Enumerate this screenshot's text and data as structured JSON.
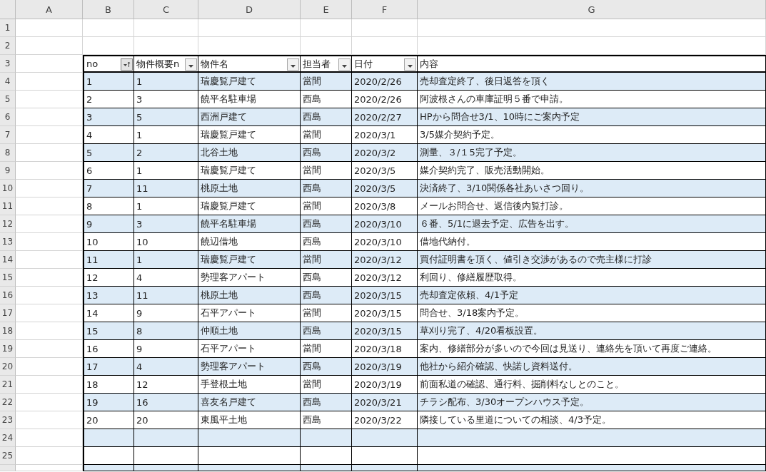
{
  "column_headings": [
    "A",
    "B",
    "C",
    "D",
    "E",
    "F",
    "G"
  ],
  "row_numbers": [
    "1",
    "2",
    "3",
    "4",
    "5",
    "6",
    "7",
    "8",
    "9",
    "10",
    "11",
    "12",
    "13",
    "14",
    "15",
    "16",
    "17",
    "18",
    "19",
    "20",
    "21",
    "22",
    "23",
    "24",
    "25"
  ],
  "table": {
    "columns": [
      {
        "label": "no",
        "filter_button": true,
        "sorted": true
      },
      {
        "label": "物件概要n",
        "filter_button": true,
        "sorted": false
      },
      {
        "label": "物件名",
        "filter_button": true,
        "sorted": false
      },
      {
        "label": "担当者",
        "filter_button": true,
        "sorted": false
      },
      {
        "label": "日付",
        "filter_button": true,
        "sorted": false
      },
      {
        "label": "内容",
        "filter_button": false,
        "sorted": false
      }
    ],
    "rows": [
      [
        "1",
        "1",
        "瑞慶覧戸建て",
        "當間",
        "2020/2/26",
        "売却査定終了、後日返答を頂く"
      ],
      [
        "2",
        "3",
        "饒平名駐車場",
        "西島",
        "2020/2/26",
        "阿波根さんの車庫証明５番で申請。"
      ],
      [
        "3",
        "5",
        "西洲戸建て",
        "西島",
        "2020/2/27",
        "HPから問合せ3/1、10時にご案内予定"
      ],
      [
        "4",
        "1",
        "瑞慶覧戸建て",
        "當間",
        "2020/3/1",
        "3/5媒介契約予定。"
      ],
      [
        "5",
        "2",
        "北谷土地",
        "西島",
        "2020/3/2",
        "測量、３/１5完了予定。"
      ],
      [
        "6",
        "1",
        "瑞慶覧戸建て",
        "當間",
        "2020/3/5",
        "媒介契約完了、販売活動開始。"
      ],
      [
        "7",
        "11",
        "桃原土地",
        "西島",
        "2020/3/5",
        "決済終了、3/10関係各社あいさつ回り。"
      ],
      [
        "8",
        "1",
        "瑞慶覧戸建て",
        "當間",
        "2020/3/8",
        "メールお問合せ、返信後内覧打診。"
      ],
      [
        "9",
        "3",
        "饒平名駐車場",
        "西島",
        "2020/3/10",
        "６番、5/1に退去予定、広告を出す。"
      ],
      [
        "10",
        "10",
        "饒辺借地",
        "西島",
        "2020/3/10",
        "借地代納付。"
      ],
      [
        "11",
        "1",
        "瑞慶覧戸建て",
        "當間",
        "2020/3/12",
        "買付証明書を頂く、値引き交渉があるので売主様に打診"
      ],
      [
        "12",
        "4",
        "勢理客アパート",
        "西島",
        "2020/3/12",
        "利回り、修繕履歴取得。"
      ],
      [
        "13",
        "11",
        "桃原土地",
        "西島",
        "2020/3/15",
        "売却査定依頼、4/1予定"
      ],
      [
        "14",
        "9",
        "石平アパート",
        "當間",
        "2020/3/15",
        "問合せ、3/18案内予定。"
      ],
      [
        "15",
        "8",
        "仲順土地",
        "西島",
        "2020/3/15",
        "草刈り完了、4/20看板設置。"
      ],
      [
        "16",
        "9",
        "石平アパート",
        "當間",
        "2020/3/18",
        "案内、修繕部分が多いので今回は見送り、連絡先を頂いて再度ご連絡。"
      ],
      [
        "17",
        "4",
        "勢理客アパート",
        "西島",
        "2020/3/19",
        "他社から紹介確認、快諾し資料送付。"
      ],
      [
        "18",
        "12",
        "手登根土地",
        "當間",
        "2020/3/19",
        "前面私道の確認、通行料、掘削料なしとのこと。"
      ],
      [
        "19",
        "16",
        "喜友名戸建て",
        "西島",
        "2020/3/21",
        "チラシ配布、3/30オープンハウス予定。"
      ],
      [
        "20",
        "20",
        "東風平土地",
        "西島",
        "2020/3/22",
        "隣接している里道についての相談、4/3予定。"
      ]
    ]
  }
}
